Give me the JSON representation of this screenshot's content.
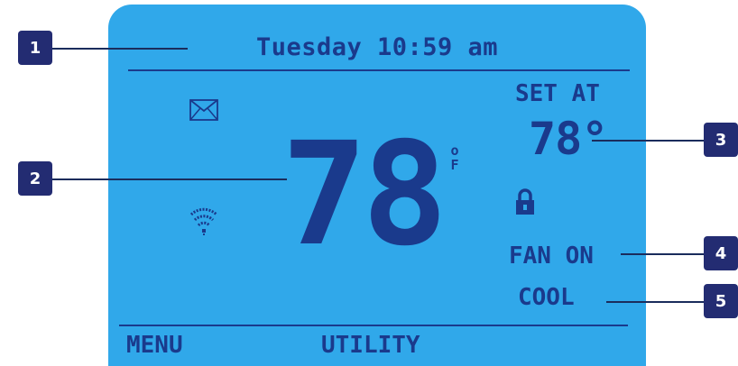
{
  "display": {
    "datetime": "Tuesday 10:59 am",
    "current_temperature": "78",
    "temperature_unit_top": "o",
    "temperature_unit_bottom": "F",
    "set_at_label": "SET AT",
    "set_at_value": "78°",
    "fan_status": "FAN ON",
    "mode_status": "COOL",
    "softkeys": {
      "left": "MENU",
      "center": "UTILITY"
    },
    "icons": [
      "mail-icon",
      "wifi-icon",
      "lock-icon"
    ]
  },
  "callouts": {
    "c1": "1",
    "c2": "2",
    "c3": "3",
    "c4": "4",
    "c5": "5"
  },
  "colors": {
    "lcd_background": "#30a8ea",
    "lcd_text": "#1a3a8c",
    "badge_background": "#232c72"
  }
}
